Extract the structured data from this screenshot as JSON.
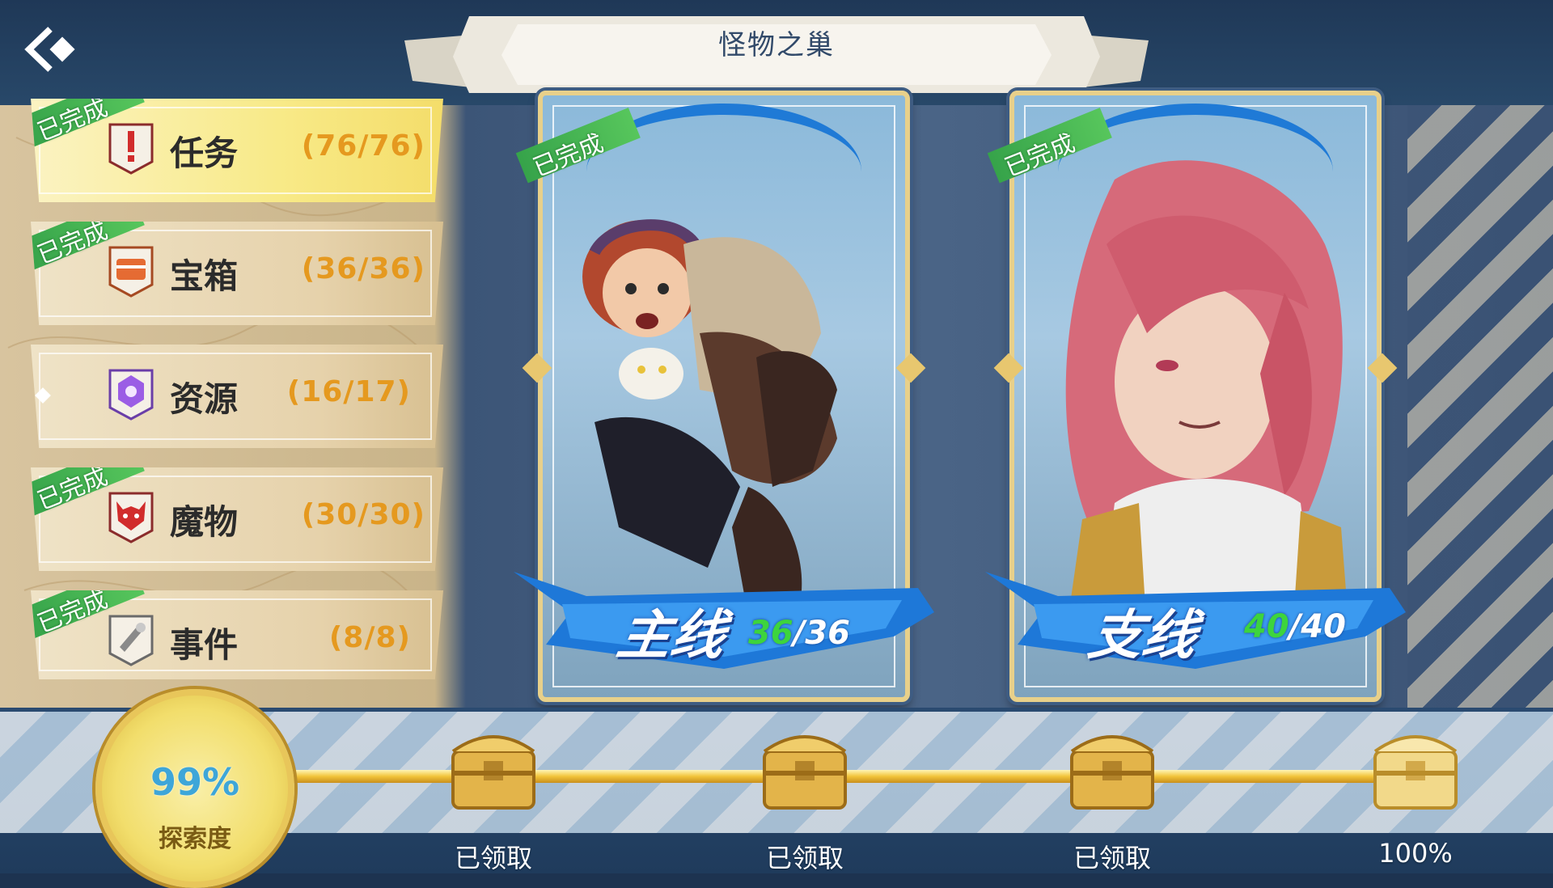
{
  "header": {
    "title": "怪物之巢"
  },
  "categories": [
    {
      "label": "任务",
      "count": "(76/76)",
      "done": "已完成",
      "icon": "quest-icon"
    },
    {
      "label": "宝箱",
      "count": "(36/36)",
      "done": "已完成",
      "icon": "treasure-icon"
    },
    {
      "label": "资源",
      "count": "(16/17)",
      "done": "",
      "icon": "resource-icon"
    },
    {
      "label": "魔物",
      "count": "(30/30)",
      "done": "已完成",
      "icon": "monster-icon"
    },
    {
      "label": "事件",
      "count": "(8/8)",
      "done": "已完成",
      "icon": "event-icon"
    }
  ],
  "cards": [
    {
      "label": "主线",
      "current": "36",
      "total": "/36",
      "done": "已完成"
    },
    {
      "label": "支线",
      "current": "40",
      "total": "/40",
      "done": "已完成"
    }
  ],
  "exploration": {
    "percent": "99%",
    "label": "探索度",
    "progress": 0.99
  },
  "rewards": [
    {
      "label": "已领取",
      "status": "claimed"
    },
    {
      "label": "已领取",
      "status": "claimed"
    },
    {
      "label": "已领取",
      "status": "claimed"
    },
    {
      "label": "100%",
      "status": "locked"
    }
  ],
  "colors": {
    "count": "#e5991f",
    "done_tag": "#3fb04f",
    "progress_current": "#3dd43d",
    "explore_pct": "#3ea6d8"
  }
}
